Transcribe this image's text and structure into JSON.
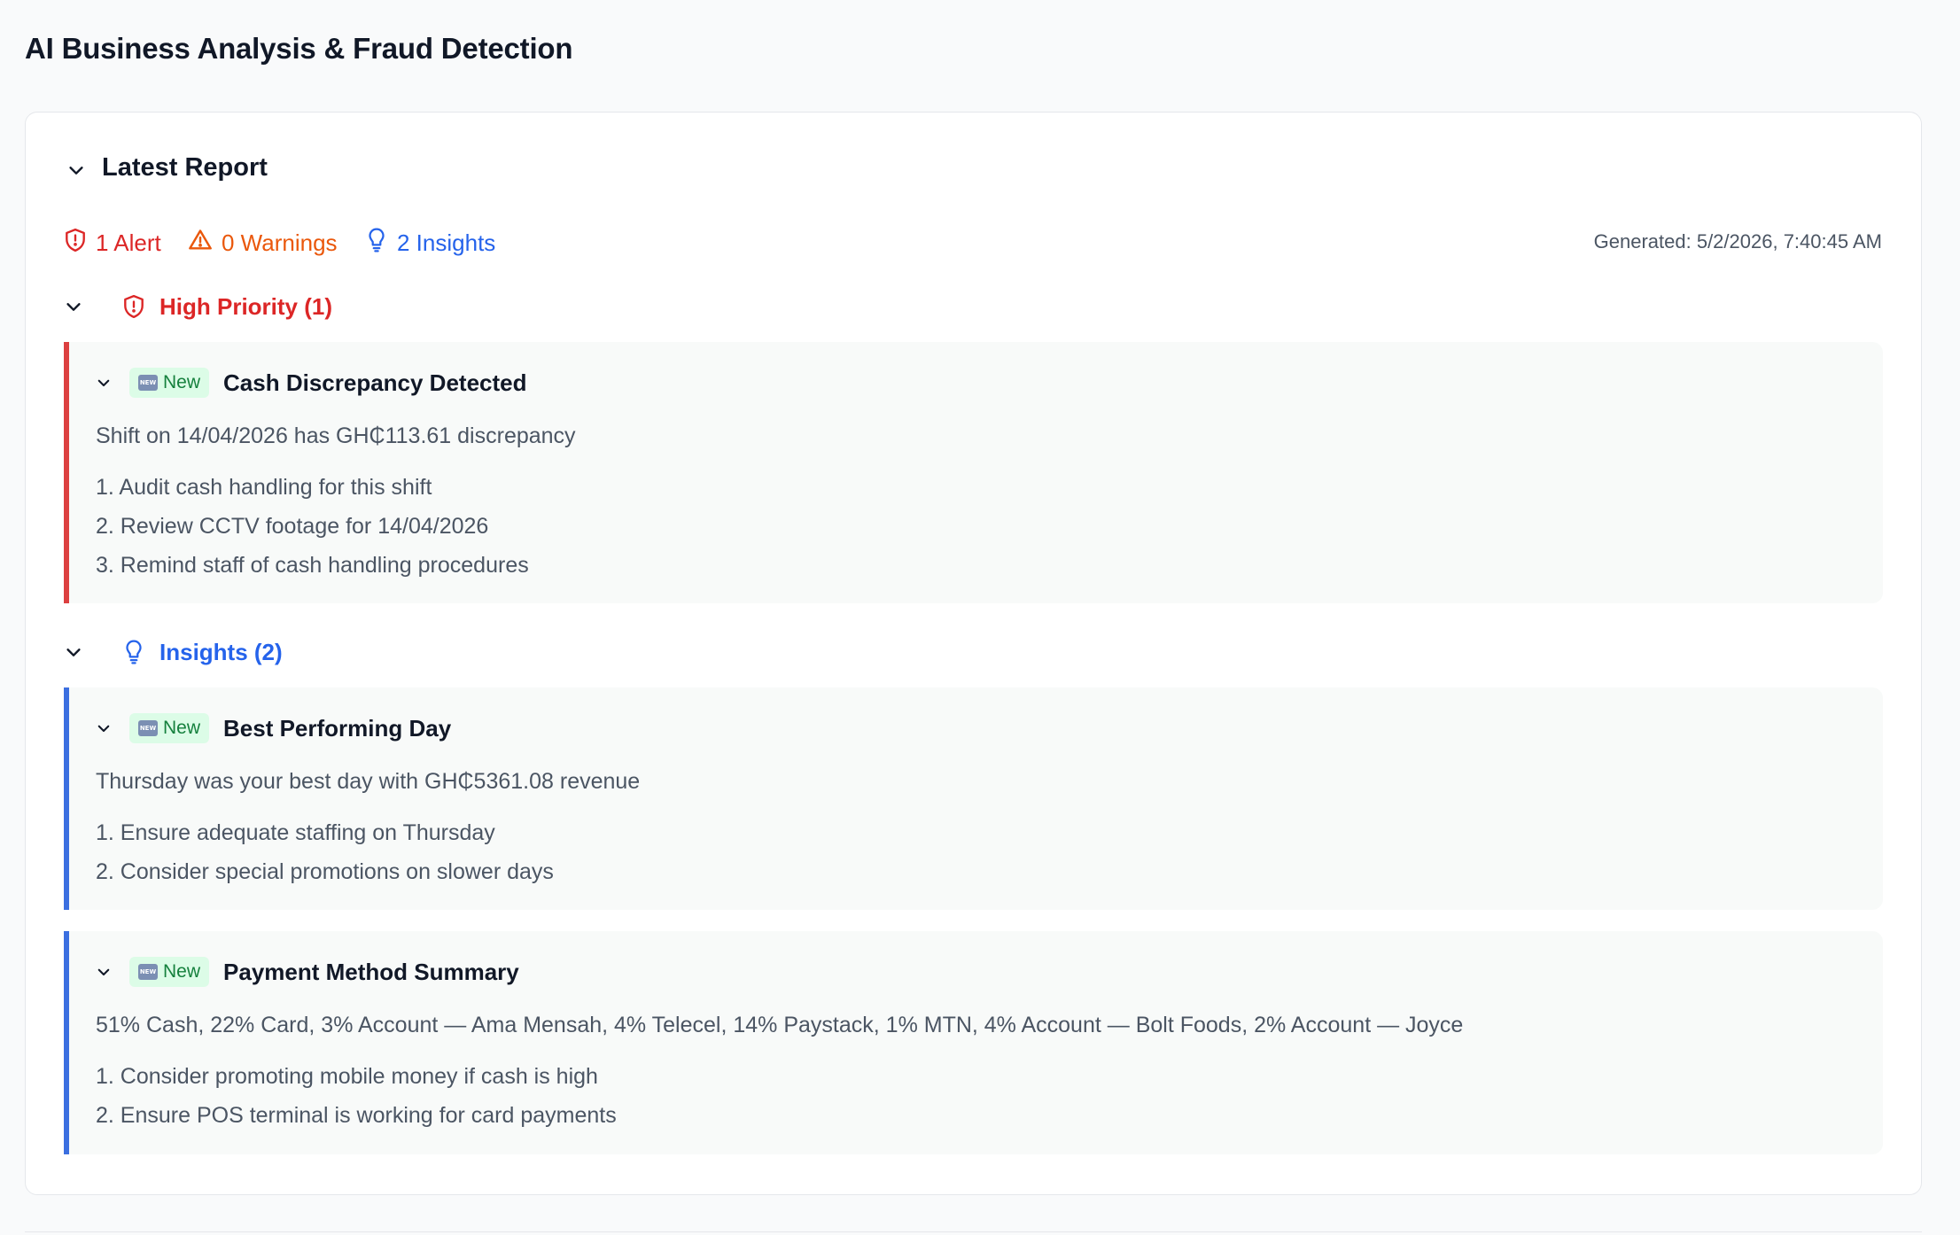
{
  "page": {
    "title": "AI Business Analysis & Fraud Detection"
  },
  "report": {
    "title": "Latest Report",
    "summary": {
      "alerts": "1 Alert",
      "warnings": "0 Warnings",
      "insights": "2 Insights"
    },
    "generated": "Generated: 5/2/2026, 7:40:45 AM"
  },
  "sections": {
    "high_priority": {
      "label": "High Priority (1)",
      "items": [
        {
          "badge": "New",
          "title": "Cash Discrepancy Detected",
          "description": "Shift on 14/04/2026 has GH₵113.61 discrepancy",
          "actions": [
            "1. Audit cash handling for this shift",
            "2. Review CCTV footage for 14/04/2026",
            "3. Remind staff of cash handling procedures"
          ]
        }
      ]
    },
    "insights": {
      "label": "Insights (2)",
      "items": [
        {
          "badge": "New",
          "title": "Best Performing Day",
          "description": "Thursday was your best day with GH₵5361.08 revenue",
          "actions": [
            "1. Ensure adequate staffing on Thursday",
            "2. Consider special promotions on slower days"
          ]
        },
        {
          "badge": "New",
          "title": "Payment Method Summary",
          "description": "51% Cash, 22% Card, 3% Account — Ama Mensah, 4% Telecel, 14% Paystack, 1% MTN, 4% Account — Bolt Foods, 2% Account — Joyce",
          "actions": [
            "1. Consider promoting mobile money if cash is high",
            "2. Ensure POS terminal is working for card payments"
          ]
        }
      ]
    }
  },
  "colors": {
    "alert": "#dc2626",
    "warning": "#ea580c",
    "insight": "#2563eb",
    "new_badge_bg": "#dcfce7",
    "new_badge_text": "#15803d"
  },
  "icons": {
    "alert": "shield-alert-icon",
    "warning": "triangle-alert-icon",
    "insight": "lightbulb-icon",
    "collapse": "chevron-down-icon",
    "new": "new-emoji-icon"
  }
}
